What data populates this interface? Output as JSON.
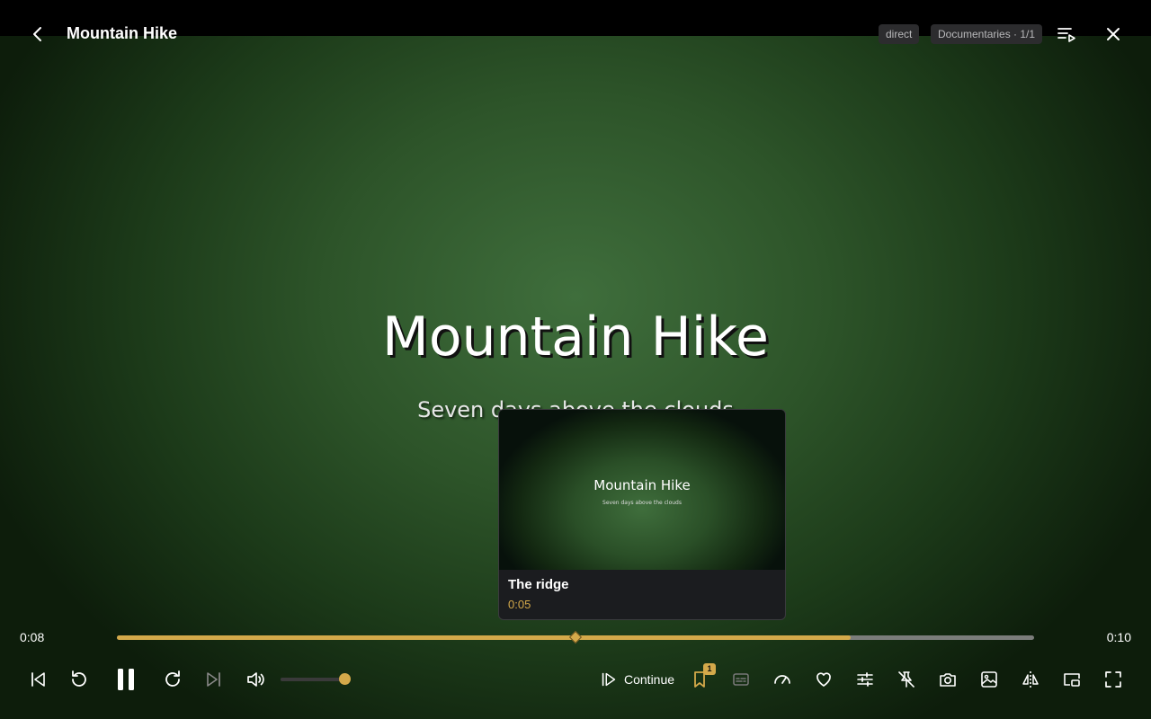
{
  "header": {
    "title": "Mountain Hike",
    "source_badge": "direct",
    "playlist_badge": "Documentaries · 1/1"
  },
  "video": {
    "title": "Mountain Hike",
    "subtitle": "Seven days above the clouds"
  },
  "preview": {
    "thumb_title": "Mountain Hike",
    "thumb_subtitle": "Seven days above the clouds",
    "chapter_name": "The ridge",
    "chapter_time": "0:05"
  },
  "playback": {
    "current_time": "0:08",
    "total_time": "0:10",
    "played_fraction": 0.8,
    "chapter_fraction": 0.5,
    "volume_fraction": 1.0
  },
  "controls": {
    "continue_label": "Continue",
    "bookmark_count": "1"
  },
  "colors": {
    "accent": "#d4a94a",
    "background": "#000000",
    "video_green": "#3f6e3c"
  },
  "icons": [
    "back-icon",
    "playlist-icon",
    "close-icon",
    "skip-previous-icon",
    "rewind-icon",
    "pause-icon",
    "forward-icon",
    "skip-next-icon",
    "volume-icon",
    "continue-icon",
    "bookmark-icon",
    "subtitles-icon",
    "speed-icon",
    "heart-icon",
    "equalizer-icon",
    "pin-off-icon",
    "camera-icon",
    "image-icon",
    "flip-icon",
    "picture-in-picture-icon",
    "fullscreen-icon"
  ]
}
